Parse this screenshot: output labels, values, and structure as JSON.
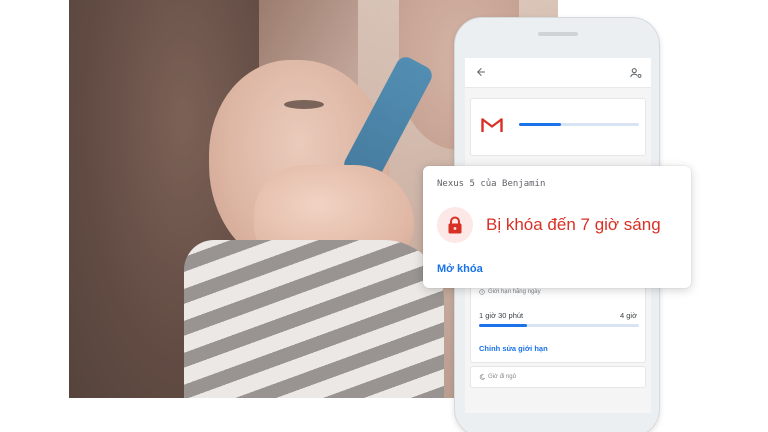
{
  "device_card": {
    "device_name": "Nexus 5 của Benjamin",
    "status": "Bị khóa đến 7 giờ sáng",
    "unlock_label": "Mở khóa",
    "icon": "lock-icon"
  },
  "phone": {
    "appbar": {
      "back_icon": "arrow-back-icon",
      "account_icon": "manage-accounts-icon"
    },
    "app_usage": {
      "app_icon": "gmail-icon",
      "progress": 0.35
    },
    "daily_limit": {
      "header": "Giới hạn hằng ngày",
      "used": "1 giờ 30 phút",
      "max": "4 giờ",
      "progress": 0.3,
      "edit_label": "Chỉnh sửa giới hạn"
    },
    "bedtime": {
      "label": "Giờ đi ngủ",
      "icon": "moon-icon"
    }
  },
  "colors": {
    "accent": "#1a73e8",
    "lock_red": "#d93025",
    "lock_bg": "#fce8e6"
  }
}
